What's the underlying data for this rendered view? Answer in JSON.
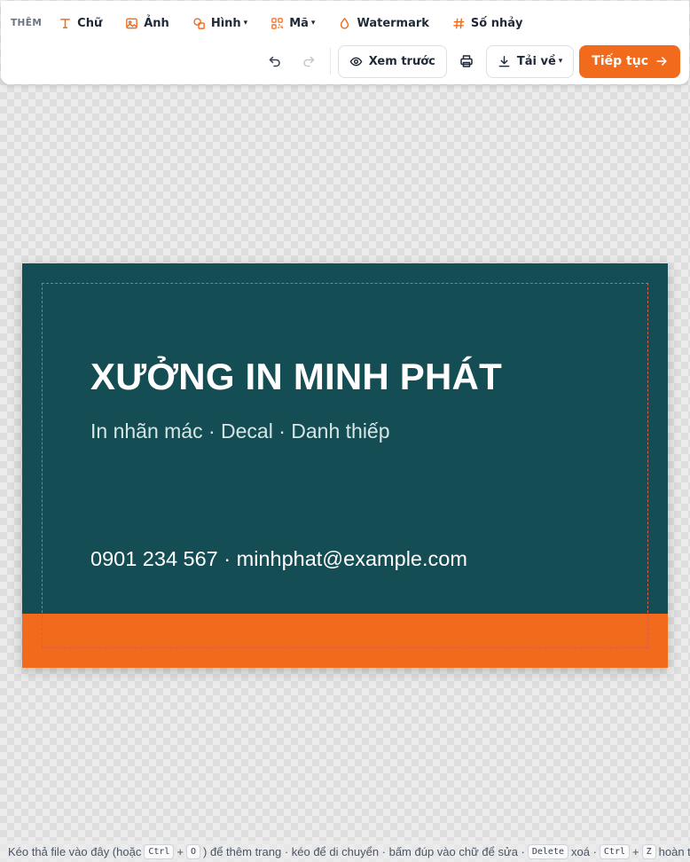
{
  "toolbar": {
    "add_label": "THÊM",
    "tools": [
      {
        "label": "Chữ",
        "icon": "text-icon"
      },
      {
        "label": "Ảnh",
        "icon": "image-icon"
      },
      {
        "label": "Hình",
        "icon": "shapes-icon",
        "dropdown": true
      },
      {
        "label": "Mã",
        "icon": "qr-code-icon",
        "dropdown": true
      },
      {
        "label": "Watermark",
        "icon": "droplet-icon"
      },
      {
        "label": "Số nhảy",
        "icon": "hash-icon"
      }
    ],
    "caret": "▾",
    "preview_label": "Xem trước",
    "download_label": "Tải về",
    "continue_label": "Tiếp tục",
    "accent_color": "#f26b1d"
  },
  "card": {
    "title": "XƯỞNG IN MINH PHÁT",
    "subtitle": "In nhãn mác · Decal · Danh thiếp",
    "contact": "0901 234 567 · minhphat@example.com",
    "background_color": "#154d54",
    "stripe_color": "#f26b1d"
  },
  "hint": {
    "part1": "Kéo thả file vào đây (hoặc",
    "key_ctrl": "Ctrl",
    "plus": "+",
    "key_o": "O",
    "part2": ") để thêm trang · kéo để di chuyển · bấm đúp vào chữ để sửa ·",
    "key_delete": "Delete",
    "part3": "xoá ·",
    "key_z": "Z",
    "part4": "hoàn tác"
  }
}
